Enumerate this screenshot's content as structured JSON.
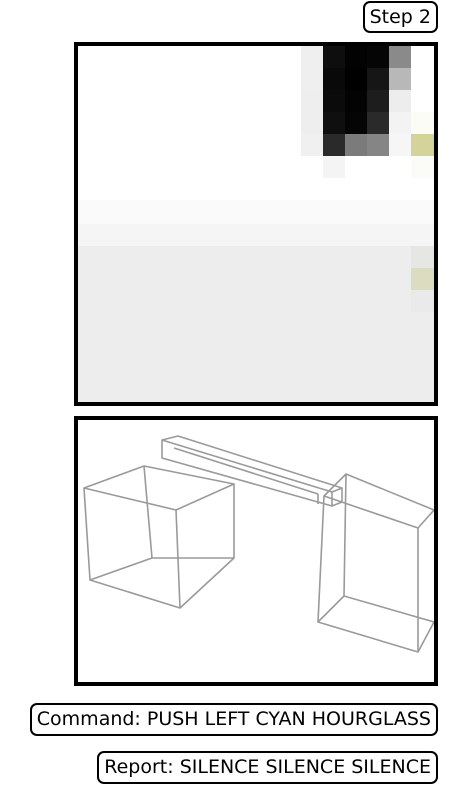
{
  "step_label": "Step 2",
  "command_label": "Command: PUSH LEFT CYAN HOURGLASS",
  "report_label": "Report: SILENCE SILENCE SILENCE",
  "colors": {
    "frame": "#000000",
    "background": "#ffffff",
    "floor": "#ededed",
    "wireframe": "#9a9a9a",
    "object_dark": "#0c0c0c",
    "object_accent": "#d4d39a"
  }
}
